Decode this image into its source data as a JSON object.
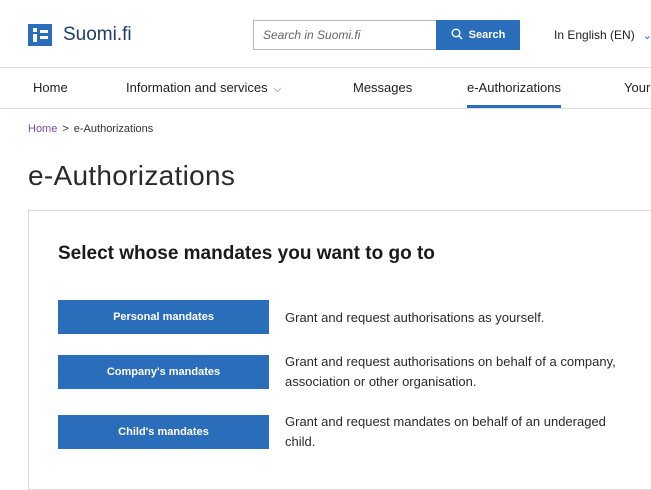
{
  "header": {
    "logo_text": "Suomi.fi",
    "search": {
      "placeholder": "Search in Suomi.fi",
      "button_label": "Search"
    },
    "language": "In English (EN)"
  },
  "nav": {
    "items": [
      {
        "label": "Home"
      },
      {
        "label": "Information and services"
      },
      {
        "label": "Messages"
      },
      {
        "label": "e-Authorizations"
      },
      {
        "label": "Your"
      }
    ]
  },
  "breadcrumb": {
    "home": "Home",
    "separator": ">",
    "current": "e-Authorizations"
  },
  "page_title": "e-Authorizations",
  "mandates": {
    "heading": "Select whose mandates you want to go to",
    "options": [
      {
        "button": "Personal mandates",
        "description": "Grant and request authorisations as yourself."
      },
      {
        "button": "Company's mandates",
        "description": "Grant and request authorisations on behalf of a company, association or other organisation."
      },
      {
        "button": "Child's mandates",
        "description": "Grant and request mandates on behalf of an underaged child."
      }
    ]
  },
  "colors": {
    "brand_blue": "#2a6ebb",
    "link_purple": "#7b4aa0",
    "logo_text": "#1f3c70"
  },
  "icons": {
    "logo": "suomi-fi-logo-icon",
    "search": "search-icon",
    "dropdown": "chevron-down-icon"
  }
}
